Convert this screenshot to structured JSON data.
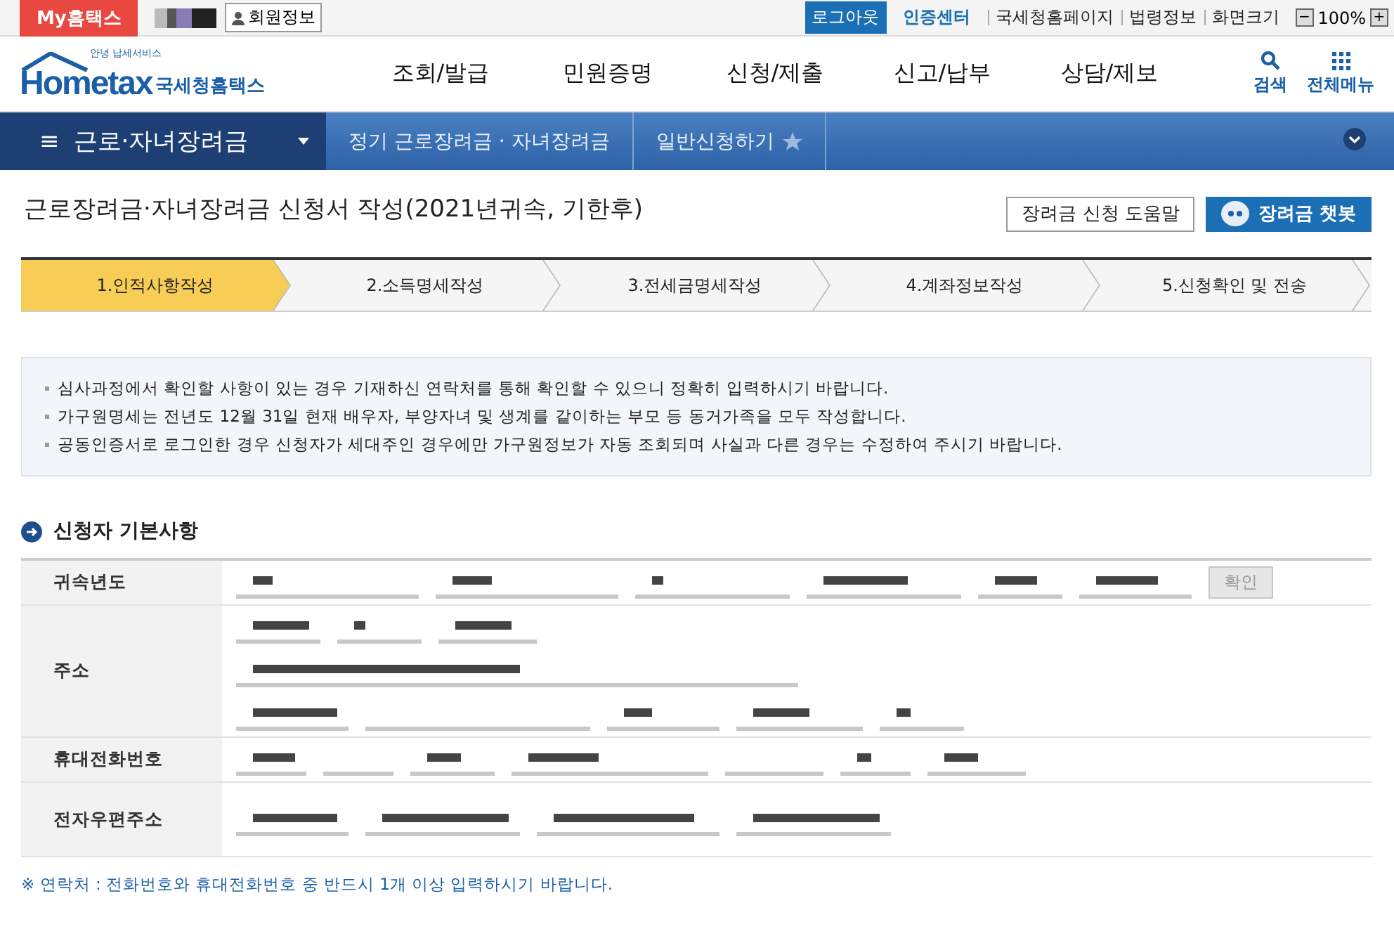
{
  "top_bar": {
    "my_button": "My홈택스",
    "member_button": "회원정보",
    "logout_button": "로그아웃",
    "cert_link": "인증센터",
    "links": [
      "국세청홈페이지",
      "법령정보",
      "화면크기"
    ],
    "zoom": "100%",
    "zoom_out": "−",
    "zoom_in": "+"
  },
  "header": {
    "logo_small": "안녕 납세서비스",
    "logo_main": "Hometax",
    "logo_sub": "국세청홈택스",
    "menu": [
      "조회/발급",
      "민원증명",
      "신청/제출",
      "신고/납부",
      "상담/제보"
    ],
    "search": "검색",
    "all_menu": "전체메뉴"
  },
  "breadcrumb": {
    "menu_icon": "≡",
    "current": "근로·자녀장려금",
    "items": [
      "정기 근로장려금 · 자녀장려금",
      "일반신청하기"
    ],
    "favorite": false
  },
  "page": {
    "title": "근로장려금·자녀장려금 신청서 작성(2021년귀속, 기한후)",
    "buttons": [
      {
        "label": "장려금 신청 도움말",
        "kind": "plain"
      },
      {
        "label": "장려금 챗봇",
        "kind": "primary"
      }
    ]
  },
  "steps": [
    {
      "label": "1.인적사항작성",
      "selected": true
    },
    {
      "label": "2.소득명세작성",
      "selected": false
    },
    {
      "label": "3.전세금명세작성",
      "selected": false
    },
    {
      "label": "4.계좌정보작성",
      "selected": false
    },
    {
      "label": "5.신청확인 및 전송",
      "selected": false
    }
  ],
  "notices": [
    "심사과정에서 확인할 사항이 있는 경우 기재하신 연락처를 통해 확인할 수 있으니 정확히 입력하시기 바랍니다.",
    "가구원명세는 전년도 12월 31일 현재 배우자, 부양자녀 및 생계를 같이하는 부모 등 동거가족을 모두 작성합니다.",
    "공동인증서로 로그인한 경우 신청자가 세대주인 경우에만 가구원정보가 자동 조회되며 사실과 다른 경우는 수정하여 주시기 바랍니다."
  ],
  "section": {
    "title": "신청자 기본사항",
    "rows": [
      {
        "label": "귀속년도",
        "kind": "year",
        "button": "확인"
      },
      {
        "label": "주소",
        "kind": "address"
      },
      {
        "label": "휴대전화번호",
        "kind": "phone"
      },
      {
        "label": "전자우편주소",
        "kind": "email"
      }
    ]
  },
  "footnote": "※ 연락처 : 전화번호와 휴대전화번호 중 반드시 1개 이상 입력하시기 바랍니다."
}
